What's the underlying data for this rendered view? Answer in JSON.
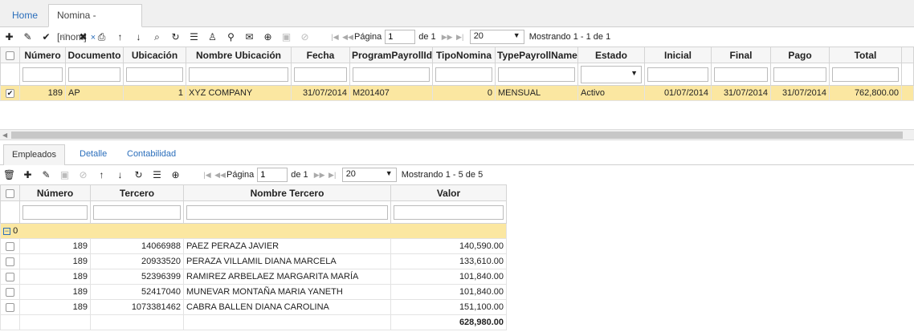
{
  "tabs": {
    "home": "Home",
    "active": "Nomina -[nnom]",
    "close": "×"
  },
  "icons": {
    "main": [
      "plus-icon",
      "edit-icon",
      "check-icon",
      "undo-icon",
      "delete-icon",
      "print-icon",
      "arrow-up-icon",
      "arrow-down-icon",
      "search-icon",
      "refresh-icon",
      "comment-icon",
      "user-icon",
      "pin-icon",
      "mail-icon",
      "add-circle-icon",
      "save-icon",
      "cancel-icon"
    ],
    "sub": [
      "trash-icon",
      "plus-icon",
      "edit-icon",
      "save-icon",
      "cancel-icon",
      "arrow-up-icon",
      "arrow-down-icon",
      "refresh-icon",
      "comment-icon",
      "add-circle-icon"
    ]
  },
  "main_pager": {
    "page_label": "Página",
    "page_value": "1",
    "of_label": "de 1",
    "page_size": "20",
    "showing": "Mostrando 1 - 1 de 1"
  },
  "main_grid": {
    "headers": [
      "Número",
      "Documento",
      "Ubicación",
      "Nombre Ubicación",
      "Fecha",
      "ProgramPayrollId",
      "TipoNomina",
      "TypePayrollName",
      "Estado",
      "Inicial",
      "Final",
      "Pago",
      "Total"
    ],
    "row": [
      "189",
      "AP",
      "1",
      "XYZ COMPANY",
      "31/07/2014",
      "M201407",
      "0",
      "MENSUAL",
      "Activo",
      "01/07/2014",
      "31/07/2014",
      "31/07/2014",
      "762,800.00"
    ]
  },
  "subtabs": [
    "Empleados",
    "Detalle",
    "Contabilidad"
  ],
  "sub_pager": {
    "page_label": "Página",
    "page_value": "1",
    "of_label": "de 1",
    "page_size": "20",
    "showing": "Mostrando 1 - 5 de 5"
  },
  "sub_grid": {
    "headers": [
      "Número",
      "Tercero",
      "Nombre Tercero",
      "Valor"
    ],
    "group_label": "0",
    "rows": [
      [
        "189",
        "14066988",
        "PAEZ PERAZA JAVIER",
        "140,590.00"
      ],
      [
        "189",
        "20933520",
        "PERAZA VILLAMIL DIANA MARCELA",
        "133,610.00"
      ],
      [
        "189",
        "52396399",
        "RAMIREZ ARBELAEZ MARGARITA MARÍA",
        "101,840.00"
      ],
      [
        "189",
        "52417040",
        "MUNEVAR MONTAÑA MARIA YANETH",
        "101,840.00"
      ],
      [
        "189",
        "1073381462",
        "CABRA BALLEN DIANA CAROLINA",
        "151,100.00"
      ]
    ],
    "total": "628,980.00"
  }
}
